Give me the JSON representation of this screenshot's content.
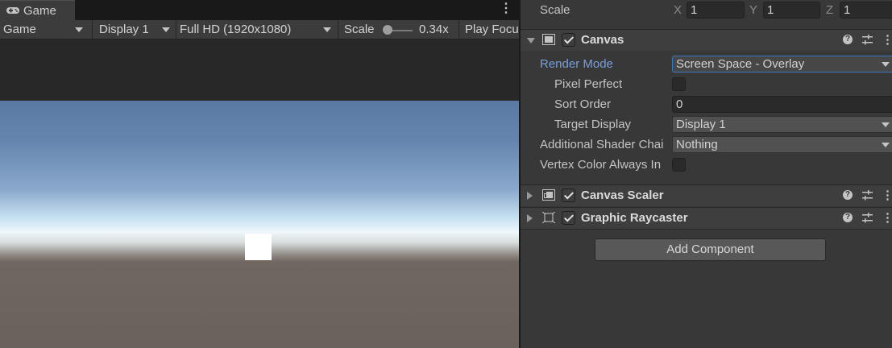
{
  "game": {
    "tab_label": "Game",
    "tab_icon": "gamepad-icon",
    "toolbar": {
      "mode_dropdown": "Game",
      "display_dropdown": "Display 1",
      "resolution_dropdown": "Full HD (1920x1080)",
      "scale_label": "Scale",
      "scale_value": "0.34x",
      "play_focus_label": "Play Focu"
    }
  },
  "inspector": {
    "transform_scale": {
      "label": "Scale",
      "x_label": "X",
      "x_value": "1",
      "y_label": "Y",
      "y_value": "1",
      "z_label": "Z",
      "z_value": "1"
    },
    "canvas": {
      "title": "Canvas",
      "enabled": true,
      "render_mode_label": "Render Mode",
      "render_mode_value": "Screen Space - Overlay",
      "pixel_perfect_label": "Pixel Perfect",
      "pixel_perfect_checked": false,
      "sort_order_label": "Sort Order",
      "sort_order_value": "0",
      "target_display_label": "Target Display",
      "target_display_value": "Display 1",
      "shader_channels_label": "Additional Shader Chai",
      "shader_channels_value": "Nothing",
      "vertex_color_label": "Vertex Color Always In",
      "vertex_color_checked": false
    },
    "canvas_scaler": {
      "title": "Canvas Scaler",
      "enabled": true
    },
    "graphic_raycaster": {
      "title": "Graphic Raycaster",
      "enabled": true
    },
    "add_component_label": "Add Component"
  },
  "colors": {
    "panel_bg": "#383838",
    "field_bg": "#2a2a2a",
    "highlight_label": "#7b9fd9",
    "focus_border": "#3a79bb"
  }
}
